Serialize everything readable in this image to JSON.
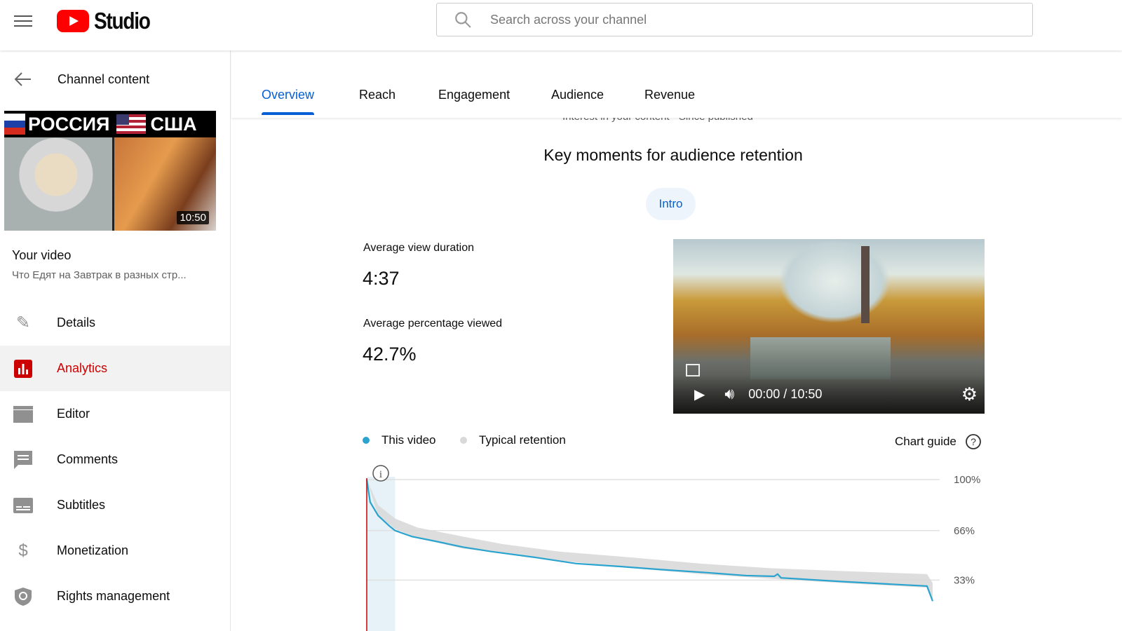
{
  "header": {
    "logo_text": "Studio",
    "search_placeholder": "Search across your channel"
  },
  "sidebar": {
    "back_label": "Channel content",
    "thumbnail": {
      "left_text": "РОССИЯ",
      "right_text": "США",
      "duration": "10:50"
    },
    "your_video_label": "Your video",
    "video_title": "Что Едят на Завтрак в разных стр...",
    "items": [
      {
        "label": "Details",
        "icon": "pencil-icon"
      },
      {
        "label": "Analytics",
        "icon": "analytics-icon",
        "active": true
      },
      {
        "label": "Editor",
        "icon": "clapperboard-icon"
      },
      {
        "label": "Comments",
        "icon": "comment-icon"
      },
      {
        "label": "Subtitles",
        "icon": "subtitles-icon"
      },
      {
        "label": "Monetization",
        "icon": "dollar-icon"
      },
      {
        "label": "Rights management",
        "icon": "shield-icon"
      }
    ]
  },
  "tabs": [
    "Overview",
    "Reach",
    "Engagement",
    "Audience",
    "Revenue"
  ],
  "active_tab": "Overview",
  "main": {
    "subtitle_partial": "Interest in your content · Since published",
    "section_title": "Key moments for audience retention",
    "chip": "Intro",
    "avg_view_duration_label": "Average view duration",
    "avg_view_duration": "4:37",
    "avg_pct_label": "Average percentage viewed",
    "avg_pct": "42.7%",
    "player": {
      "time": "00:00 / 10:50"
    },
    "chart_guide": "Chart guide"
  },
  "colors": {
    "accent": "#065fd4",
    "active_red": "#cc0000",
    "this_video": "#2aa3cf",
    "typical": "#d9d9d9",
    "marker": "#cc0000"
  },
  "chart_data": {
    "type": "area",
    "ylabel": "",
    "yticks": [
      "100%",
      "66%",
      "33%"
    ],
    "legend": [
      {
        "name": "This video",
        "color": "#2aa3cf"
      },
      {
        "name": "Typical retention",
        "color": "#d9d9d9"
      }
    ],
    "legend_placement": "top-left",
    "grid": true,
    "x_unit": "percent of video",
    "highlight": {
      "label": "Intro",
      "x_range": [
        0,
        5
      ]
    },
    "series": [
      {
        "name": "This video",
        "x": [
          0,
          0.6,
          2,
          4,
          5,
          8,
          12,
          17,
          22,
          30,
          37,
          45,
          52,
          60,
          67,
          72,
          72.6,
          73.2,
          84,
          94,
          99,
          100
        ],
        "y": [
          100,
          85,
          76,
          69,
          66,
          62,
          59,
          55,
          52,
          48,
          44,
          42,
          40,
          38,
          36,
          35.5,
          37,
          34.5,
          32,
          30,
          29,
          19
        ]
      },
      {
        "name": "Typical retention upper",
        "x": [
          0,
          2,
          5,
          9,
          17,
          24,
          34,
          47,
          59,
          71,
          84,
          99,
          100
        ],
        "y": [
          100,
          83,
          74,
          68,
          62,
          57,
          52,
          48,
          44,
          41,
          39,
          37,
          31
        ]
      },
      {
        "name": "Typical retention lower",
        "x": [
          0,
          2,
          5,
          9,
          17,
          24,
          34,
          47,
          59,
          71,
          84,
          99,
          100
        ],
        "y": [
          100,
          76,
          67,
          61,
          54,
          51,
          46,
          41,
          37,
          34,
          31,
          28,
          19
        ]
      }
    ]
  }
}
